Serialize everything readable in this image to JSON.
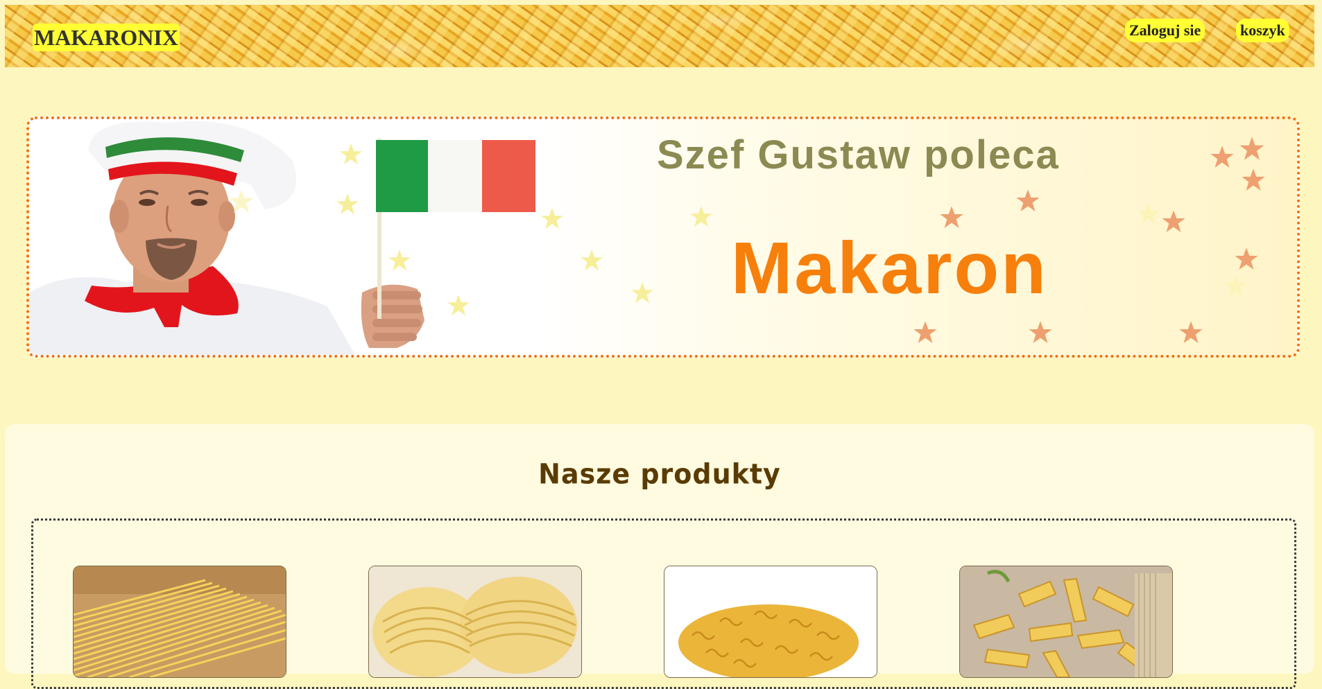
{
  "header": {
    "logo": "MAKARONIX",
    "login_label": "Zaloguj sie",
    "cart_label": "koszyk"
  },
  "banner": {
    "slogan_top": "Szef Gustaw poleca",
    "slogan_main": "Makaron"
  },
  "products": {
    "title": "Nasze produkty",
    "items": [
      {
        "image": "spaghetti-photo"
      },
      {
        "image": "tagliatelle-nests-photo"
      },
      {
        "image": "fusilli-photo"
      },
      {
        "image": "penne-photo"
      }
    ]
  },
  "colors": {
    "page_bg": "#fdf6bf",
    "accent_yellow": "#ffff33",
    "banner_orange": "#f77f0b",
    "title_brown": "#5a3b05"
  }
}
